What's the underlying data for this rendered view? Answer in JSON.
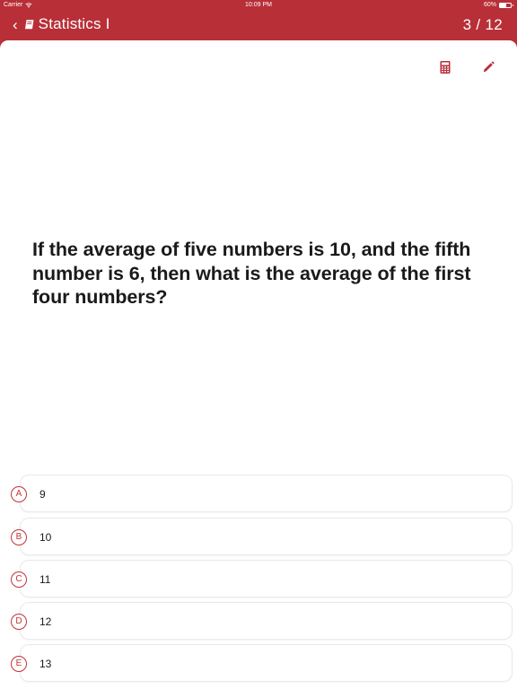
{
  "status": {
    "carrier": "Carrier",
    "time": "10:09 PM",
    "battery": "60%",
    "battery_level": 0.6
  },
  "nav": {
    "back_icon": "chevron-left-icon",
    "book_icon": "book-icon",
    "title": "Statistics I",
    "progress": "3 / 12"
  },
  "tools": {
    "calculator_icon": "calculator-icon",
    "pencil_icon": "pencil-icon"
  },
  "question": "If the average of five numbers is 10, and the fifth number is 6, then what is the average of the first four numbers?",
  "choices": [
    {
      "letter": "A",
      "text": "9"
    },
    {
      "letter": "B",
      "text": "10"
    },
    {
      "letter": "C",
      "text": "11"
    },
    {
      "letter": "D",
      "text": "12"
    },
    {
      "letter": "E",
      "text": "13"
    }
  ],
  "colors": {
    "brand": "#b82f37",
    "accent": "#c2323a",
    "text": "#1a1a1a",
    "card_border": "#e9e9ec"
  }
}
